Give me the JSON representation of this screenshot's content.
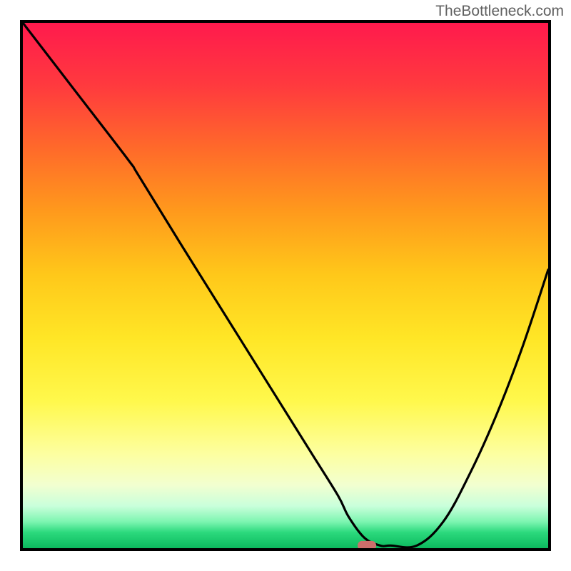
{
  "watermark": "TheBottleneck.com",
  "chart_data": {
    "type": "line",
    "title": "",
    "xlabel": "",
    "ylabel": "",
    "xlim": [
      0,
      100
    ],
    "ylim": [
      0,
      100
    ],
    "x": [
      0,
      10,
      20,
      22,
      30,
      40,
      50,
      55,
      60,
      62,
      65,
      68,
      70,
      75,
      80,
      85,
      90,
      95,
      100
    ],
    "values": [
      100,
      87,
      74,
      71,
      58,
      42,
      26,
      18,
      10,
      6,
      2,
      0.5,
      0.5,
      0.5,
      5,
      14,
      25,
      38,
      53
    ],
    "marker": {
      "x": 65.5,
      "y": 0.5,
      "color": "#cc6e6b"
    },
    "background_gradient": {
      "top": "#ff1a4d",
      "mid": "#ffe626",
      "bottom": "#0db85e"
    },
    "annotations": []
  }
}
